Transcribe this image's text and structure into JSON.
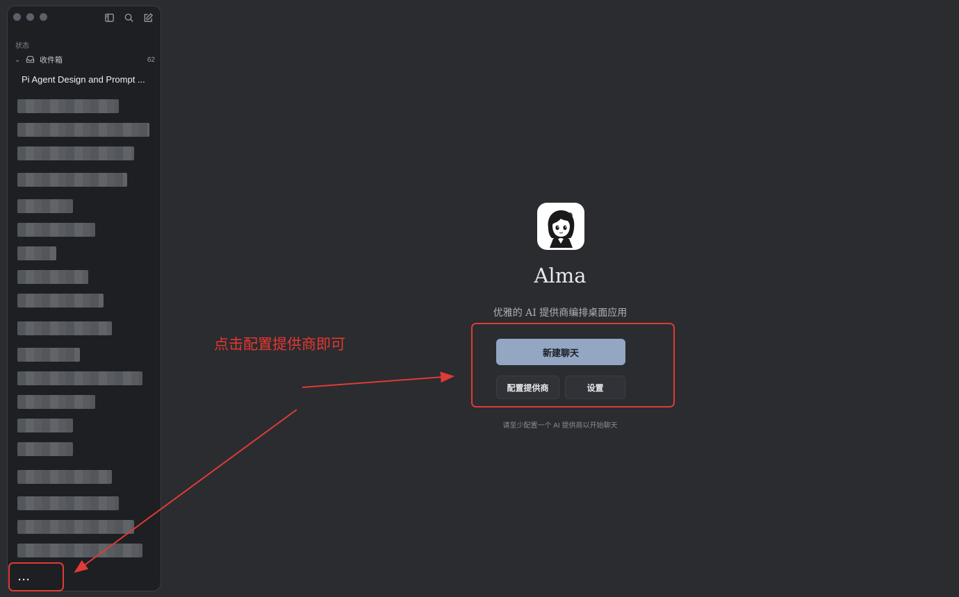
{
  "sidebar": {
    "toolbar": {
      "icons": [
        "sidebar-toggle-icon",
        "search-icon",
        "compose-icon"
      ]
    },
    "section_label": "状态",
    "inbox": {
      "label": "收件箱",
      "count": "62"
    },
    "active_chat": "Pi Agent Design and Prompt ...",
    "more_label": "···"
  },
  "main": {
    "app_name": "Alma",
    "tagline": "优雅的 AI 提供商编排桌面应用",
    "buttons": {
      "new_chat": "新建聊天",
      "configure_provider": "配置提供商",
      "settings": "设置"
    },
    "hint": "请至少配置一个 AI 提供商以开始聊天"
  },
  "annotation": {
    "text": "点击配置提供商即可",
    "color": "#e8362f"
  },
  "colors": {
    "background": "#2a2c30",
    "sidebar": "#1d1f23",
    "accent_button": "#93a6c2"
  }
}
